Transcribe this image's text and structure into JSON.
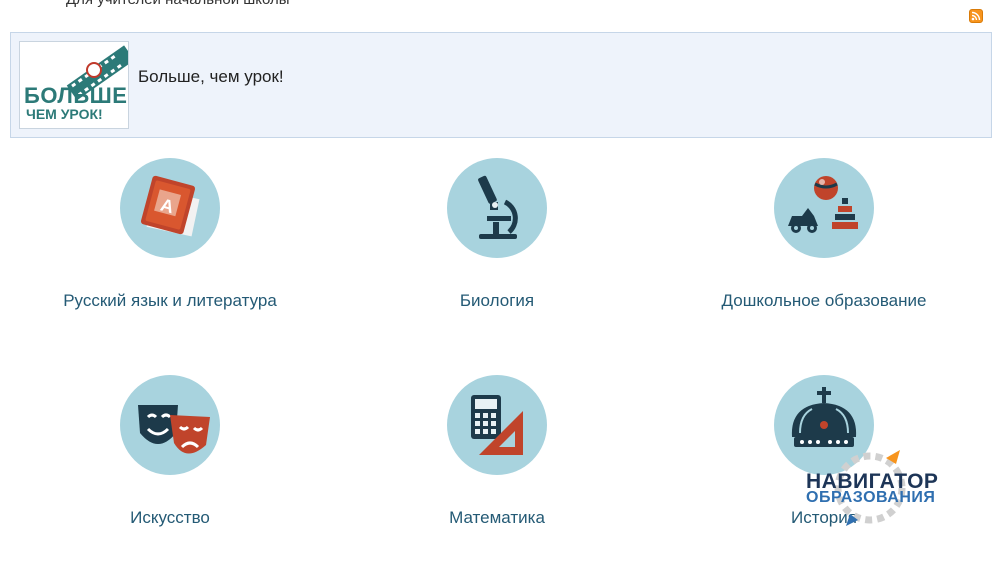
{
  "top_text": "Для учителей начальной школы",
  "rss": {
    "icon": "rss-icon"
  },
  "banner": {
    "logo_line1": "БОЛЬШЕ,",
    "logo_line2": "ЧЕМ УРОК!",
    "title": "Больше, чем урок!"
  },
  "subjects": [
    {
      "label": "Русский язык и литература",
      "icon": "book-icon"
    },
    {
      "label": "Биология",
      "icon": "microscope-icon"
    },
    {
      "label": "Дошкольное образование",
      "icon": "toys-icon"
    },
    {
      "label": "Искусство",
      "icon": "theater-masks-icon"
    },
    {
      "label": "Математика",
      "icon": "calculator-ruler-icon"
    },
    {
      "label": "История",
      "icon": "crown-icon"
    }
  ],
  "watermark": {
    "line1": "НАВИГАТОР",
    "line2": "ОБРАЗОВАНИЯ"
  },
  "colors": {
    "circle": "#a8d3de",
    "label": "#245a75",
    "banner_bg": "#eef3fb",
    "accent_orange": "#f7941d"
  }
}
